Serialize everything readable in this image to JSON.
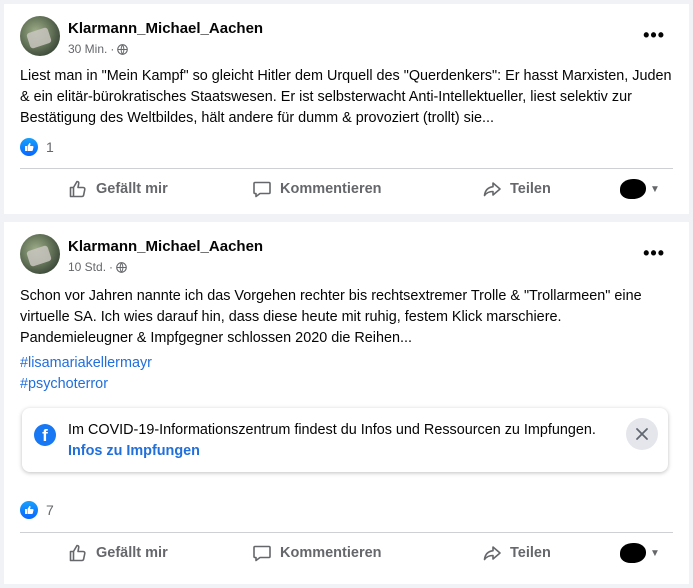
{
  "posts": [
    {
      "author": "Klarmann_Michael_Aachen",
      "time": "30 Min.",
      "text": "Liest man in \"Mein Kampf\" so gleicht Hitler dem Urquell des \"Querdenkers\": Er hasst Marxisten, Juden & ein elitär-bürokratisches Staatswesen. Er ist selbsterwacht Anti-Intellektueller, liest selektiv zur Bestätigung des Weltbildes, hält andere für dumm & provoziert (trollt) sie...",
      "reaction_count": "1"
    },
    {
      "author": "Klarmann_Michael_Aachen",
      "time": "10 Std.",
      "text": "Schon vor Jahren nannte ich das Vorgehen rechter bis rechtsextremer Trolle & \"Trollarmeen\" eine virtuelle SA. Ich wies darauf hin, dass diese heute mit ruhig, festem Klick marschiere. Pandemieleugner & Impfgegner schlossen 2020 die Reihen...",
      "hashtags": [
        "#lisamariakellermayr",
        "#psychoterror"
      ],
      "info_box": {
        "text": "Im COVID-19-Informationszentrum findest du Infos und Ressourcen zu Impfungen.",
        "link": "Infos zu Impfungen"
      },
      "reaction_count": "7"
    }
  ],
  "meta_separator": "·",
  "more_label": "•••",
  "actions": {
    "like": "Gefällt mir",
    "comment": "Kommentieren",
    "share": "Teilen"
  },
  "icons": {
    "like": "thumbs-up-icon",
    "comment": "speech-bubble-icon",
    "share": "share-arrow-icon",
    "privacy": "globe-icon",
    "close": "close-icon"
  },
  "colors": {
    "link": "#216fdb",
    "like_badge": "#0866ff",
    "secondary_text": "#65676b"
  }
}
